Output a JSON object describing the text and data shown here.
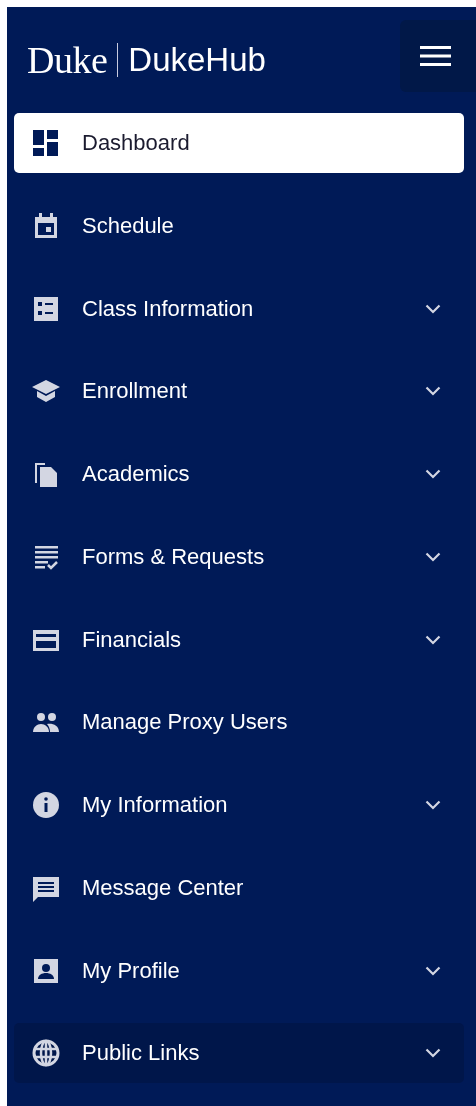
{
  "header": {
    "logo_wordmark": "Duke",
    "app_name": "DukeHub"
  },
  "nav": {
    "items": [
      {
        "label": "Dashboard",
        "selected": true,
        "hovered": false,
        "expandable": false
      },
      {
        "label": "Schedule",
        "selected": false,
        "hovered": false,
        "expandable": false
      },
      {
        "label": "Class Information",
        "selected": false,
        "hovered": false,
        "expandable": true
      },
      {
        "label": "Enrollment",
        "selected": false,
        "hovered": false,
        "expandable": true
      },
      {
        "label": "Academics",
        "selected": false,
        "hovered": false,
        "expandable": true
      },
      {
        "label": "Forms & Requests",
        "selected": false,
        "hovered": false,
        "expandable": true
      },
      {
        "label": "Financials",
        "selected": false,
        "hovered": false,
        "expandable": true
      },
      {
        "label": "Manage Proxy Users",
        "selected": false,
        "hovered": false,
        "expandable": false
      },
      {
        "label": "My Information",
        "selected": false,
        "hovered": false,
        "expandable": true
      },
      {
        "label": "Message Center",
        "selected": false,
        "hovered": false,
        "expandable": false
      },
      {
        "label": "My Profile",
        "selected": false,
        "hovered": false,
        "expandable": true
      },
      {
        "label": "Public Links",
        "selected": false,
        "hovered": true,
        "expandable": true
      }
    ]
  }
}
